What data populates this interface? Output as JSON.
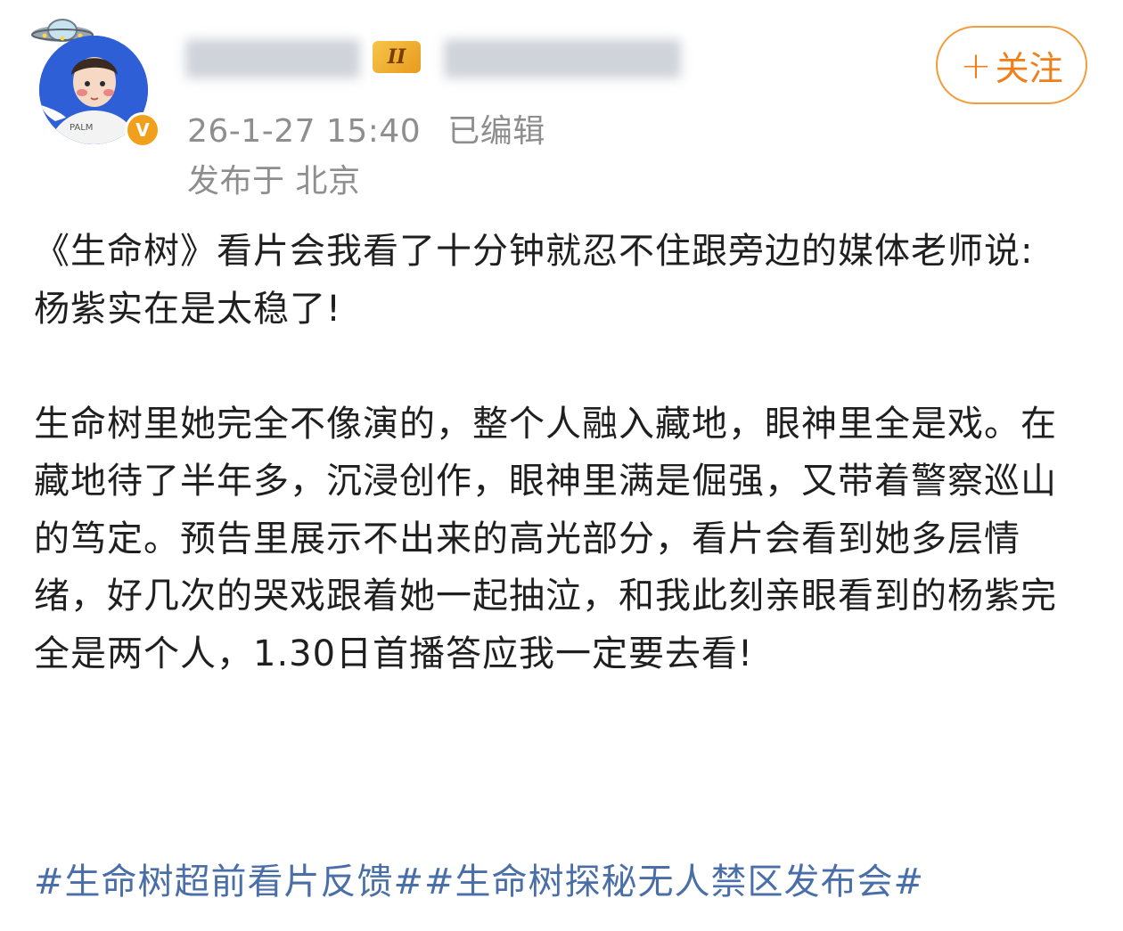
{
  "header": {
    "level_badge": "II",
    "verified_mark": "V",
    "timestamp": "26-1-27 15:40",
    "edited_label": "已编辑",
    "location": "发布于 北京",
    "follow_label": "关注",
    "follow_icon": "+"
  },
  "post": {
    "paragraphs": [
      "《生命树》看片会我看了十分钟就忍不住跟旁边的媒体老师说:\n杨紫实在是太稳了!",
      "生命树里她完全不像演的，整个人融入藏地，眼神里全是戏。在藏地待了半年多，沉浸创作，眼神里满是倔强，又带着警察巡山的笃定。预告里展示不出来的高光部分，看片会看到她多层情绪，好几次的哭戏跟着她一起抽泣，和我此刻亲眼看到的杨紫完全是两个人，1.30日首播答应我一定要去看!"
    ],
    "hashtags": [
      "#生命树超前看片反馈#",
      "#生命树探秘无人禁区发布会#"
    ]
  },
  "colors": {
    "accent_orange": "#f07f1a",
    "hashtag_blue": "#4a6fa8",
    "meta_gray": "#8e8e8e",
    "verified_gold": "#f2a01b"
  }
}
